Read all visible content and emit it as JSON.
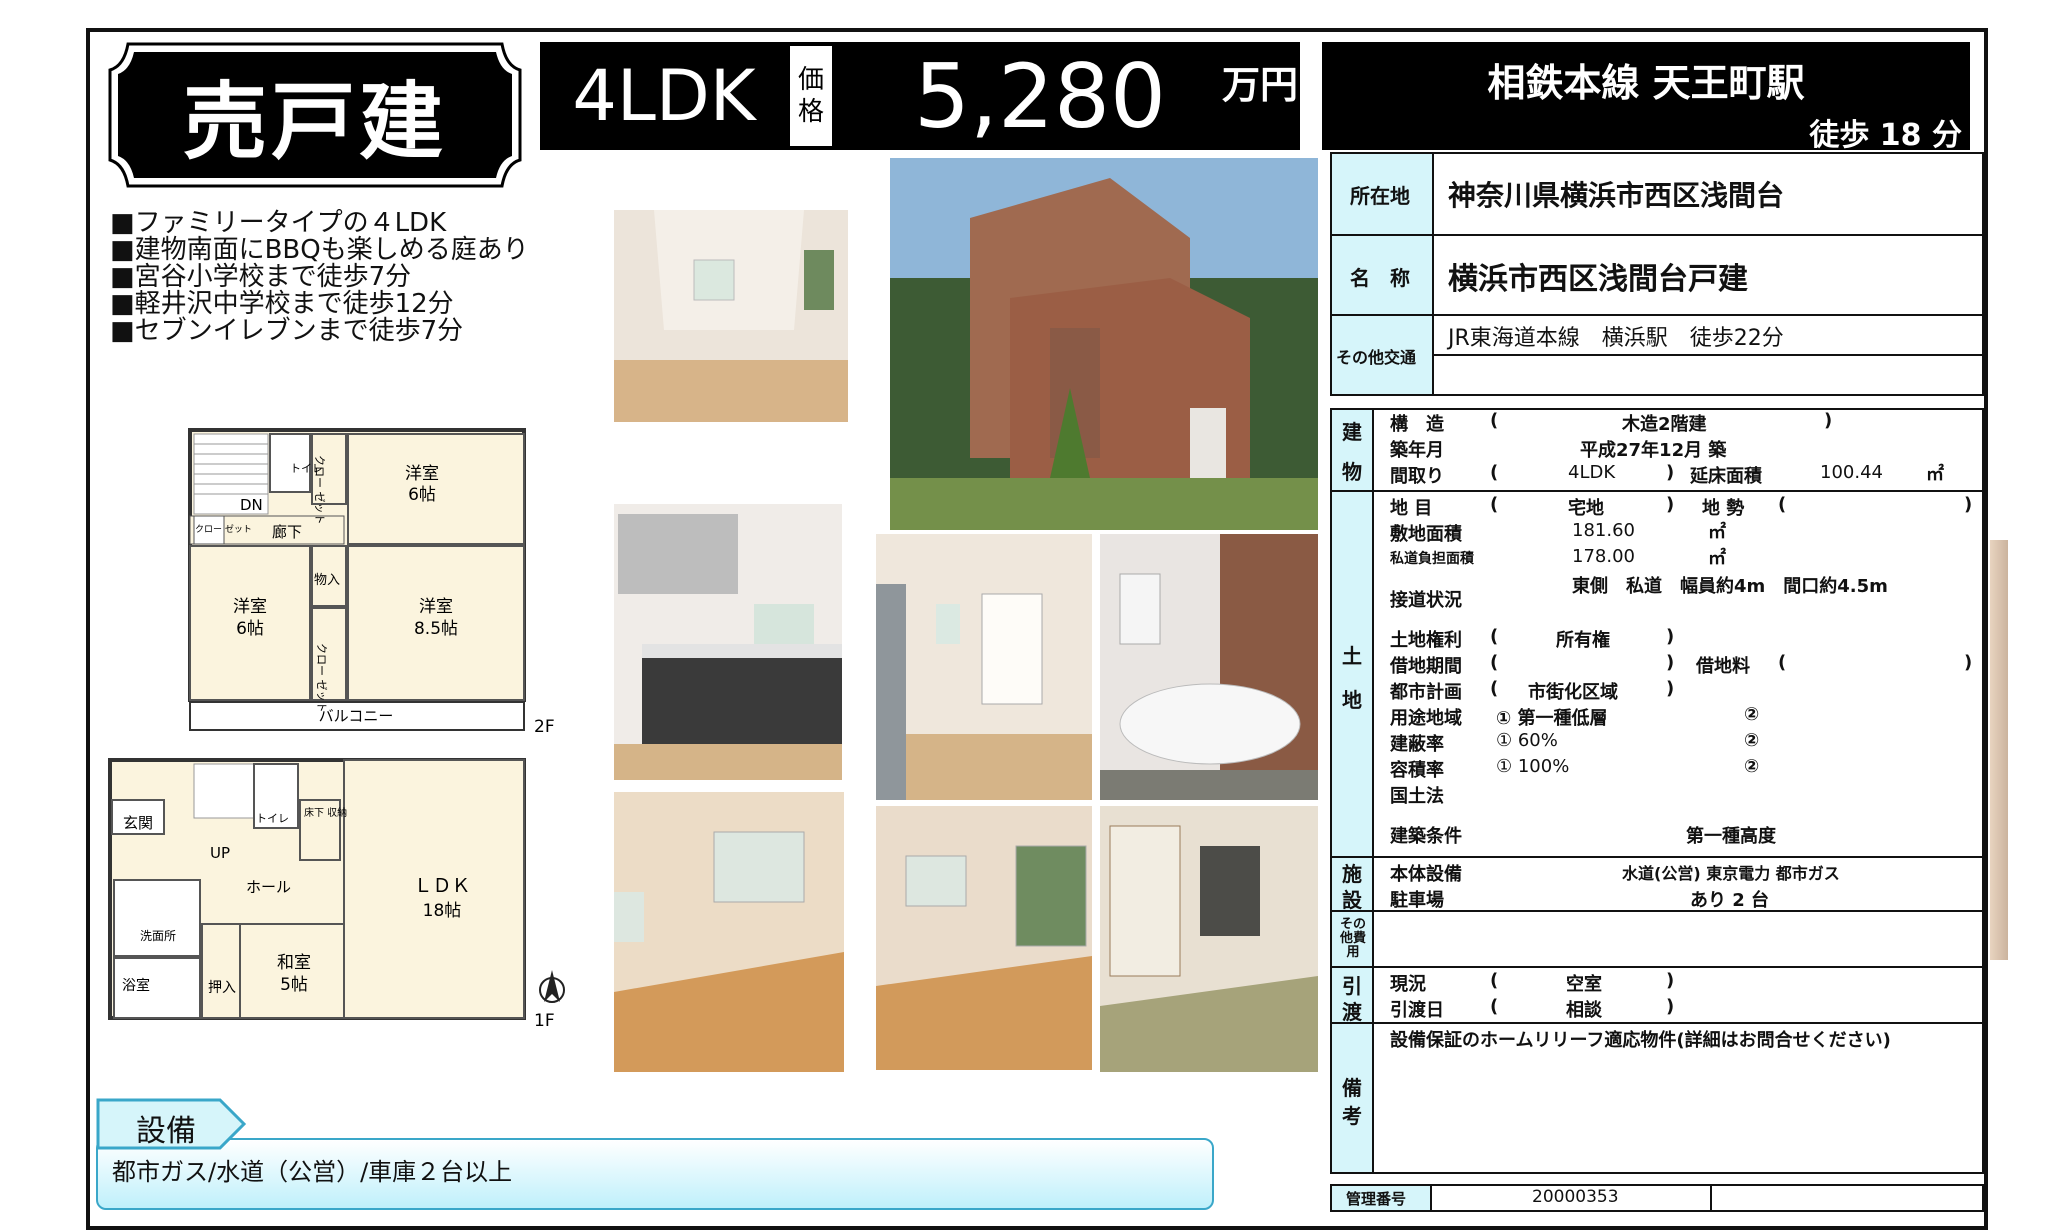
{
  "header": {
    "property_type": "売戸建",
    "layout_type": "4LDK",
    "price_label_chars": [
      "価",
      "格"
    ],
    "price_value": "5,280",
    "price_unit": "万円",
    "station_name": "相鉄本線 天王町駅",
    "station_walk": "徒歩 18 分"
  },
  "features": [
    "■ファミリータイプの４LDK",
    "■建物南面にBBQも楽しめる庭あり",
    "■宮谷小学校まで徒歩7分",
    "■軽井沢中学校まで徒歩12分",
    "■セブンイレブンまで徒歩7分"
  ],
  "floor_plan": {
    "floor2_label": "2F",
    "floor1_label": "1F",
    "rooms_2f": {
      "toilet": "トイレ",
      "closet_a": "クロー ゼット",
      "room_ne_name": "洋室",
      "room_ne_size": "6帖",
      "dn": "DN",
      "closet_small": "クロー ゼット",
      "hallway": "廊下",
      "room_w_name": "洋室",
      "room_w_size": "6帖",
      "storage": "物入",
      "room_c_name": "洋室",
      "room_c_size": "8.5帖",
      "closet_b": "クロー ゼット",
      "balcony": "バルコニー"
    },
    "rooms_1f": {
      "entrance": "玄関",
      "toilet": "トイレ",
      "underfloor": "床下 収納",
      "up": "UP",
      "hall": "ホール",
      "ldk_name": "ＬＤＫ",
      "ldk_size": "18帖",
      "washroom": "洗面所",
      "bath": "浴室",
      "oshiire": "押入",
      "washitsu_name": "和室",
      "washitsu_size": "5帖"
    }
  },
  "info": {
    "location_label": "所在地",
    "location_value": "神奈川県横浜市西区浅間台",
    "name_label": "名　称",
    "name_value": "横浜市西区浅間台戸建",
    "transport_label": "その他交通",
    "transport_value": "JR東海道本線　横浜駅　徒歩22分"
  },
  "building": {
    "section_label": [
      "建",
      "物"
    ],
    "structure_label": "構　造",
    "structure_value": "木造2階建",
    "built_label": "築年月",
    "built_value": "平成27年12月 築",
    "layout_label": "間取り",
    "layout_value": "4LDK",
    "floor_area_label": "延床面積",
    "floor_area_value": "100.44",
    "area_unit": "㎡",
    "paren_open": "(",
    "paren_close": ")"
  },
  "land": {
    "section_label": [
      "土",
      "地"
    ],
    "category_label": "地 目",
    "category_value": "宅地",
    "terrain_label": "地 勢",
    "site_area_label": "敷地面積",
    "site_area_value": "181.60",
    "private_road_label": "私道負担面積",
    "private_road_value": "178.00",
    "access_label": "接道状況",
    "access_value": "東側　私道　幅員約4m　間口約4.5m",
    "rights_label": "土地権利",
    "rights_value": "所有権",
    "lease_period_label": "借地期間",
    "lease_fee_label": "借地料",
    "city_plan_label": "都市計画",
    "city_plan_value": "市街化区域",
    "zoning_label": "用途地域",
    "zoning_value_1": "① 第一種低層",
    "zoning_value_2": "②",
    "coverage_label": "建蔽率",
    "coverage_value_1": "① 60%",
    "coverage_value_2": "②",
    "far_label": "容積率",
    "far_value_1": "① 100%",
    "far_value_2": "②",
    "land_law_label": "国土法",
    "building_cond_label": "建築条件",
    "building_cond_value": "第一種高度"
  },
  "facilities": {
    "section_label": [
      "施",
      "設"
    ],
    "utilities_label": "本体設備",
    "utilities_value": "水道(公営) 東京電力 都市ガス",
    "parking_label": "駐車場",
    "parking_value": "あり 2 台",
    "other_costs_label": "その 他費 用"
  },
  "handover": {
    "section_label": [
      "引",
      "渡"
    ],
    "status_label": "現況",
    "status_value": "空室",
    "date_label": "引渡日",
    "date_value": "相談"
  },
  "remarks": {
    "section_label": [
      "備",
      "考"
    ],
    "text": "設備保証のホームリリーフ適応物件(詳細はお問合せください)"
  },
  "management": {
    "label": "管理番号",
    "number": "20000353"
  },
  "equipment": {
    "tag": "設備",
    "text": "都市ガス/水道（公営）/車庫２台以上"
  },
  "colors": {
    "label_bg": "#d6f5fa",
    "equip_border": "#3aa7c9",
    "black": "#000000"
  }
}
